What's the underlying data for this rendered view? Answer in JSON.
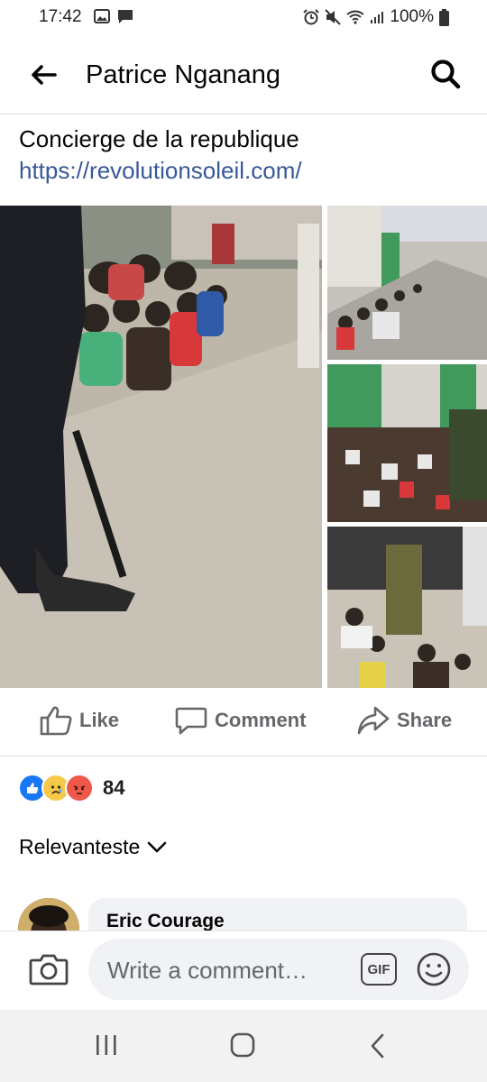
{
  "status_bar": {
    "time": "17:42",
    "battery": "100%"
  },
  "header": {
    "title": "Patrice Nganang"
  },
  "post": {
    "text": "Concierge de la republique",
    "link": "https://revolutionsoleil.com/"
  },
  "actions": {
    "like": "Like",
    "comment": "Comment",
    "share": "Share"
  },
  "reactions": {
    "count": "84",
    "icons": [
      "like-icon",
      "sad-icon",
      "angry-icon"
    ]
  },
  "comments": {
    "sort_label": "Relevanteste",
    "preview": {
      "author": "Eric Courage"
    }
  },
  "composer": {
    "placeholder": "Write a comment…",
    "gif_label": "GIF"
  },
  "colors": {
    "link": "#385898",
    "like_blue": "#1877f2",
    "angry": "#f0574b",
    "sad": "#f7c94a"
  }
}
